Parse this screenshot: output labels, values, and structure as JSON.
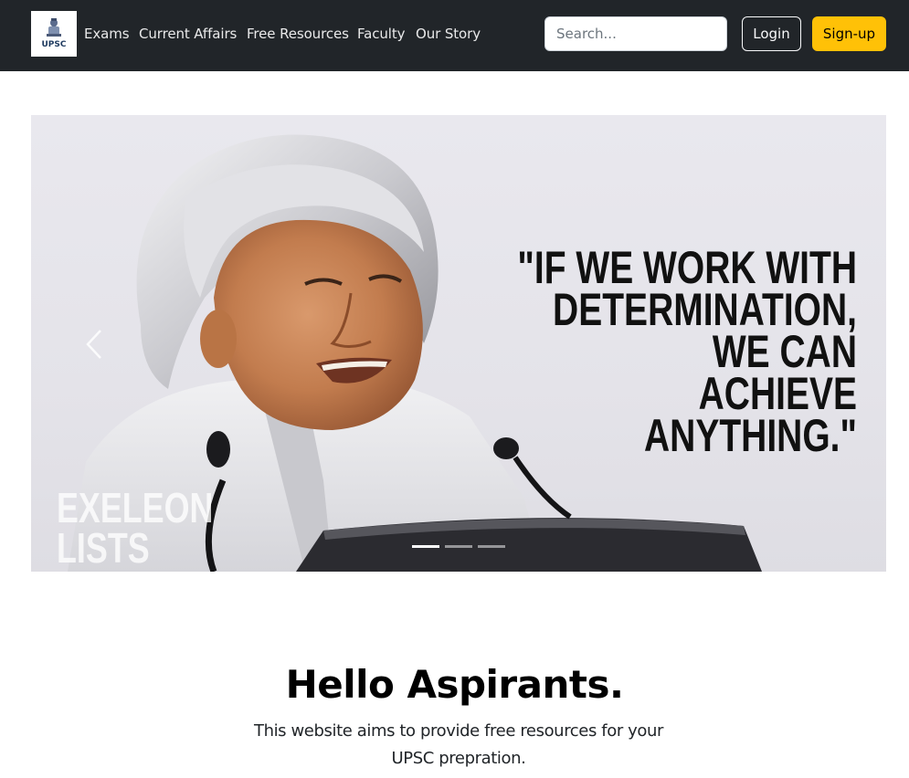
{
  "nav": {
    "logo_text": "UPSC",
    "links": [
      "Exams",
      "Current Affairs",
      "Free Resources",
      "Faculty",
      "Our Story"
    ],
    "search_placeholder": "Search...",
    "login_label": "Login",
    "signup_label": "Sign-up",
    "colors": {
      "bar": "#212529",
      "signup": "#ffc107"
    }
  },
  "carousel": {
    "quote": "\"IF WE WORK WITH\nDETERMINATION, WE CAN\nACHIEVE ANYTHING.\"",
    "watermark": "EXELEON\nLISTS",
    "active_slide": 1,
    "slide_count": 3,
    "prev_icon": "chevron-left-icon"
  },
  "hero": {
    "title": "Hello Aspirants.",
    "subtitle": "This website aims to provide free resources for your UPSC prepration."
  }
}
